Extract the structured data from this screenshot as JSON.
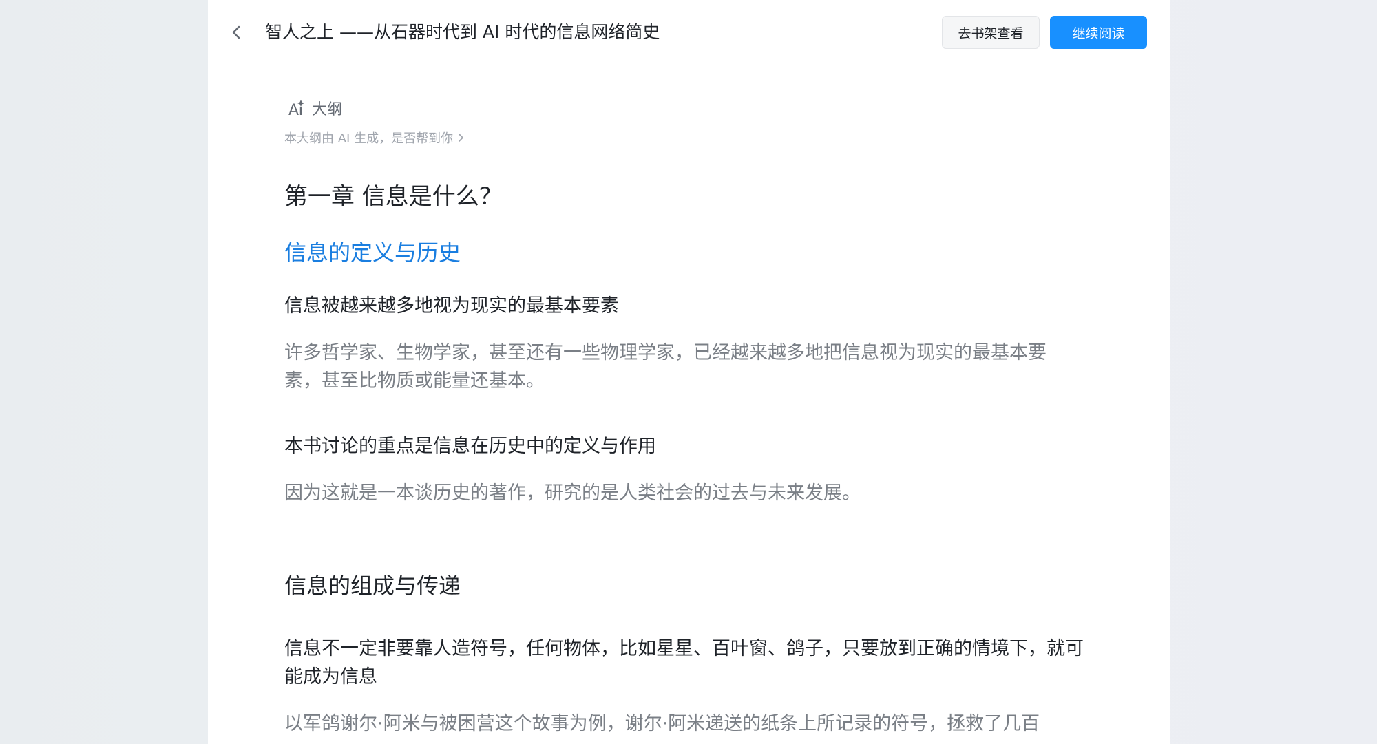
{
  "header": {
    "back_icon": "chevron-left-icon",
    "title": "智人之上 ——从石器时代到 AI 时代的信息网络简史",
    "bookshelf_button": "去书架查看",
    "continue_button": "继续阅读",
    "primary_color": "#1890ff"
  },
  "outline": {
    "ai_badge": "AI",
    "label": "大纲",
    "note": "本大纲由 AI 生成，是否帮到你",
    "note_icon": "chevron-right-icon",
    "chapter_title": "第一章 信息是什么？",
    "sections": [
      {
        "title": "信息的定义与历史",
        "active": true,
        "points": [
          {
            "title": "信息被越来越多地视为现实的最基本要素",
            "body": "许多哲学家、生物学家，甚至还有一些物理学家，已经越来越多地把信息视为现实的最基本要素，甚至比物质或能量还基本。"
          },
          {
            "title": "本书讨论的重点是信息在历史中的定义与作用",
            "body": "因为这就是一本谈历史的著作，研究的是人类社会的过去与未来发展。"
          }
        ]
      },
      {
        "title": "信息的组成与传递",
        "active": false,
        "points": [
          {
            "title": "信息不一定非要靠人造符号，任何物体，比如星星、百叶窗、鸽子，只要放到正确的情境下，就可能成为信息",
            "body": "以军鸽谢尔·阿米与被困营这个故事为例，谢尔·阿米递送的纸条上所记录的符号，拯救了几百"
          }
        ]
      }
    ]
  }
}
